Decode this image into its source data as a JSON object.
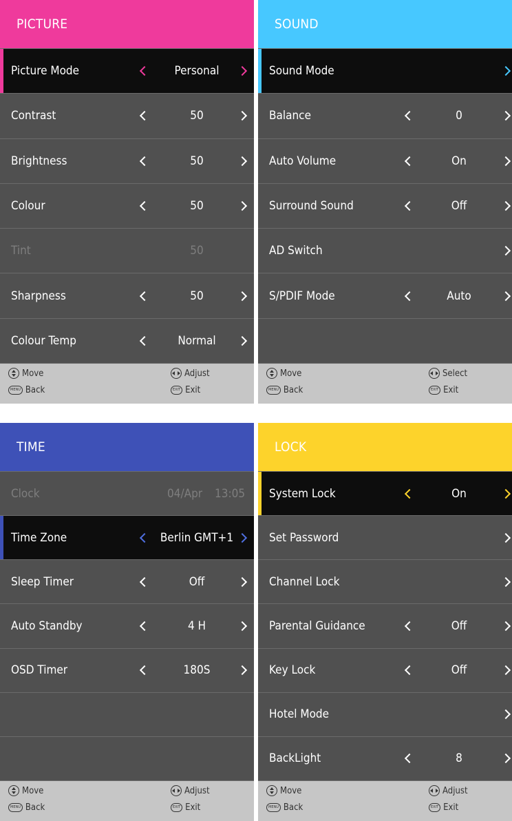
{
  "footer": {
    "move": "Move",
    "back": "Back",
    "adjust": "Adjust",
    "select": "Select",
    "exit": "Exit",
    "menu_key": "MENU",
    "exit_key": "EXIT"
  },
  "picture": {
    "title": "PICTURE",
    "accent": "#ef3a9c",
    "rows": [
      {
        "label": "Picture Mode",
        "value": "Personal"
      },
      {
        "label": "Contrast",
        "value": "50"
      },
      {
        "label": "Brightness",
        "value": "50"
      },
      {
        "label": "Colour",
        "value": "50"
      },
      {
        "label": "Tint",
        "value": "50"
      },
      {
        "label": "Sharpness",
        "value": "50"
      },
      {
        "label": "Colour Temp",
        "value": "Normal"
      }
    ]
  },
  "sound": {
    "title": "SOUND",
    "accent": "#47c8ff",
    "rows": [
      {
        "label": "Sound Mode"
      },
      {
        "label": "Balance",
        "value": "0"
      },
      {
        "label": "Auto Volume",
        "value": "On"
      },
      {
        "label": "Surround Sound",
        "value": "Off"
      },
      {
        "label": "AD Switch"
      },
      {
        "label": "S/PDIF Mode",
        "value": "Auto"
      }
    ]
  },
  "time": {
    "title": "TIME",
    "accent": "#3e51b7",
    "rows": [
      {
        "label": "Clock",
        "date": "04/Apr",
        "time": "13:05"
      },
      {
        "label": "Time Zone",
        "value": "Berlin GMT+1"
      },
      {
        "label": "Sleep Timer",
        "value": "Off"
      },
      {
        "label": "Auto Standby",
        "value": "4 H"
      },
      {
        "label": "OSD Timer",
        "value": "180S"
      }
    ]
  },
  "lock": {
    "title": "LOCK",
    "accent": "#fdd32b",
    "rows": [
      {
        "label": "System Lock",
        "value": "On"
      },
      {
        "label": "Set Password"
      },
      {
        "label": "Channel Lock"
      },
      {
        "label": "Parental Guidance",
        "value": "Off"
      },
      {
        "label": "Key Lock",
        "value": "Off"
      },
      {
        "label": "Hotel Mode"
      },
      {
        "label": "BackLight",
        "value": "8"
      }
    ]
  }
}
